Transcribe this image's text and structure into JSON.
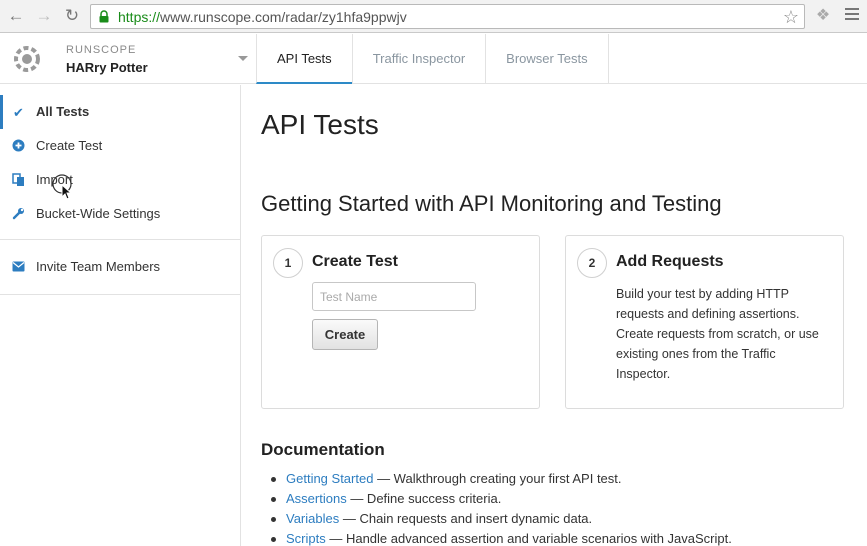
{
  "browser": {
    "url_scheme": "https://",
    "url_rest": "www.runscope.com/radar/zy1hfa9ppwjv"
  },
  "header": {
    "brand": "RUNSCOPE",
    "bucket_name": "HARry Potter",
    "tabs": [
      {
        "label": "API Tests",
        "active": true
      },
      {
        "label": "Traffic Inspector",
        "active": false
      },
      {
        "label": "Browser Tests",
        "active": false
      }
    ]
  },
  "sidebar": {
    "items": [
      {
        "label": "All Tests",
        "icon": "check-icon",
        "active": true
      },
      {
        "label": "Create Test",
        "icon": "plus-circle-icon",
        "active": false
      },
      {
        "label": "Import",
        "icon": "import-icon",
        "active": false
      },
      {
        "label": "Bucket-Wide Settings",
        "icon": "wrench-icon",
        "active": false
      }
    ],
    "secondary": [
      {
        "label": "Invite Team Members",
        "icon": "envelope-icon"
      }
    ]
  },
  "main": {
    "title": "API Tests",
    "getting_started_title": "Getting Started with API Monitoring and Testing",
    "step1": {
      "number": "1",
      "title": "Create Test",
      "input_placeholder": "Test Name",
      "button_label": "Create"
    },
    "step2": {
      "number": "2",
      "title": "Add Requests",
      "text": "Build your test by adding HTTP requests and defining assertions. Create requests from scratch, or use existing ones from the Traffic Inspector."
    },
    "documentation": {
      "title": "Documentation",
      "links": [
        {
          "label": "Getting Started",
          "desc": " — Walkthrough creating your first API test."
        },
        {
          "label": "Assertions",
          "desc": " — Define success criteria."
        },
        {
          "label": "Variables",
          "desc": " — Chain requests and insert dynamic data."
        },
        {
          "label": "Scripts",
          "desc": " — Handle advanced assertion and variable scenarios with JavaScript."
        }
      ]
    }
  },
  "colors": {
    "accent": "#2d7dc0",
    "url_secure": "#1a8c1a"
  }
}
